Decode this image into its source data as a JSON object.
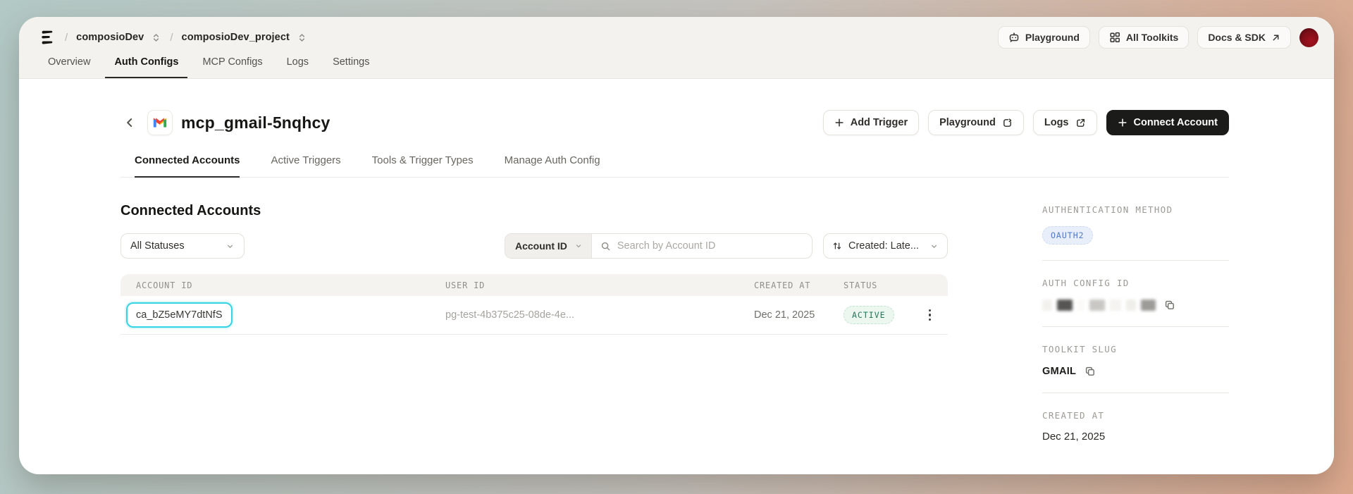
{
  "topbar": {
    "separator": "/",
    "org": "composioDev",
    "project": "composioDev_project",
    "playground_label": "Playground",
    "all_toolkits_label": "All Toolkits",
    "docs_label": "Docs & SDK"
  },
  "nav": {
    "items": [
      {
        "label": "Overview"
      },
      {
        "label": "Auth Configs"
      },
      {
        "label": "MCP Configs"
      },
      {
        "label": "Logs"
      },
      {
        "label": "Settings"
      }
    ]
  },
  "page": {
    "title": "mcp_gmail-5nqhcy",
    "actions": {
      "add_trigger": "Add Trigger",
      "playground": "Playground",
      "logs": "Logs",
      "connect_account": "Connect Account"
    }
  },
  "detail_tabs": {
    "items": [
      {
        "label": "Connected Accounts"
      },
      {
        "label": "Active Triggers"
      },
      {
        "label": "Tools & Trigger Types"
      },
      {
        "label": "Manage Auth Config"
      }
    ]
  },
  "main": {
    "heading": "Connected Accounts",
    "filters": {
      "status": "All Statuses",
      "field": "Account ID",
      "search_placeholder": "Search by Account ID",
      "sort": "Created: Late..."
    },
    "table": {
      "columns": [
        "ACCOUNT ID",
        "USER ID",
        "CREATED AT",
        "STATUS"
      ],
      "rows": [
        {
          "account_id": "ca_bZ5eMY7dtNfS",
          "user_id": "pg-test-4b375c25-08de-4e...",
          "created_at": "Dec 21, 2025",
          "status": "ACTIVE"
        }
      ]
    }
  },
  "sidebar": {
    "auth_method_label": "AUTHENTICATION METHOD",
    "auth_method_value": "OAUTH2",
    "auth_config_id_label": "AUTH CONFIG ID",
    "toolkit_slug_label": "TOOLKIT SLUG",
    "toolkit_slug_value": "GMAIL",
    "created_at_label": "CREATED AT",
    "created_at_value": "Dec 21, 2025"
  },
  "colors": {
    "bg_gradient_left": "#b3c9c6",
    "bg_gradient_right": "#dca88d",
    "connect_button_bg": "#1b1b1a",
    "active_badge_text": "#23745a",
    "active_badge_bg": "#ecf7f0",
    "oauth_badge_text": "#4f78cb",
    "oauth_badge_bg": "#e9effa",
    "click_highlight": "#35d3e4"
  }
}
